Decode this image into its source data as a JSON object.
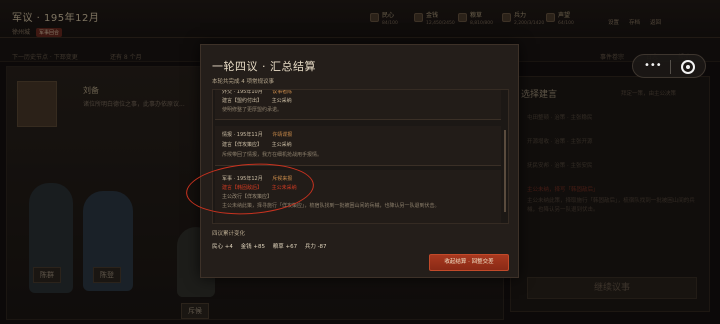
{
  "header": {
    "title": "军议 · 195年12月",
    "location": "徐州城",
    "tag": "军事回合"
  },
  "stats": [
    {
      "label": "民心",
      "value": "84/100",
      "icon": "heart-icon"
    },
    {
      "label": "金钱",
      "value": "12,450/2450",
      "icon": "coin-icon"
    },
    {
      "label": "粮草",
      "value": "8,810/800",
      "icon": "grain-icon"
    },
    {
      "label": "兵力",
      "value": "2,200/3/1420",
      "icon": "soldier-icon"
    },
    {
      "label": "声望",
      "value": "64/100",
      "icon": "flag-icon"
    }
  ],
  "top_nav": [
    "设置",
    "存档",
    "返回"
  ],
  "subbar": {
    "next_event": "下一历史节点 · 下邳变更",
    "remaining": "还有 8 个月",
    "event_list": "事件卷宗",
    "log": "日志",
    "help": "帮助"
  },
  "speaker": {
    "name": "刘备",
    "line": "诸位所明白德位之事，此事办依原议..."
  },
  "figure_labels": [
    "陈群",
    "陈登",
    "斥候"
  ],
  "right_panel": {
    "title": "选择建言",
    "hint": "拜定一策，由主公决策",
    "items": [
      "屯田整顿 · 治策 · 主张稳民",
      "开源增收 · 治策 · 主张开源",
      "抚民安邦 · 治策 · 主张安民"
    ],
    "highlight": "主公未纳，择写「韩固敌后」",
    "text": "主公未纳此策，择取施行「韩固敌后」，梳宿队找到一批被困山间的兵械，也降认另一队退到伏击。",
    "button": "继续议事"
  },
  "modal": {
    "title": "一轮四议 · 汇总结算",
    "subtitle": "本轮共完成 4 项常规议事",
    "entries": [
      {
        "type": "外交",
        "date": "195年10月",
        "speaker": "议事者陈",
        "proposal": "建言【盟约付出】",
        "decision": "主公采纳",
        "detail": "使明修整了更厚盟约承诺。"
      },
      {
        "type": "情报",
        "date": "195年11月",
        "speaker": "许靖谍报",
        "proposal": "建言【佯攻策应】",
        "decision": "主公采纳",
        "detail": "斥候带回了情报，我方在细机抢战用手报情。"
      },
      {
        "type": "军事",
        "date": "195年12月",
        "speaker": "斥候来报",
        "proposal": "建言【韩固敌后】",
        "decision": "主公未采纳",
        "executed": "主公改行【佯攻策应】",
        "detail": "主公未纳此策，择寻施行「佯攻策应」，梳宿队找到一批被困山间的兵械，也降认另一队退到伏击。"
      }
    ],
    "totals_label": "四议累计变化",
    "totals": [
      "民心 +4",
      "金钱 +85",
      "粮草 +67",
      "兵力 -87"
    ],
    "confirm": "收起结算 · 回整交差"
  },
  "capsule": {
    "dots": "•••"
  }
}
